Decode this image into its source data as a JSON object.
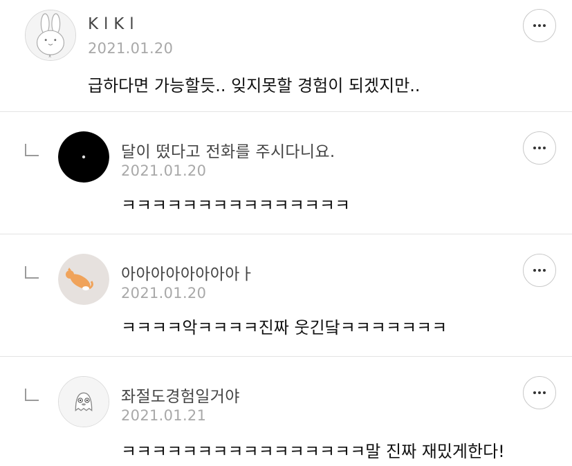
{
  "comments": [
    {
      "nickname": "K l K l",
      "date": "2021.01.20",
      "text": "급하다면 가능할듯.. 잊지못할 경험이 되겠지만..",
      "avatar_icon": "bunny-avatar-icon",
      "is_reply": false
    },
    {
      "nickname": "달이 떴다고 전화를 주시다니요.",
      "date": "2021.01.20",
      "text": "ㅋㅋㅋㅋㅋㅋㅋㅋㅋㅋㅋㅋㅋㅋㅋ",
      "avatar_icon": "black-circle-avatar-icon",
      "is_reply": true
    },
    {
      "nickname": "아아아아아아아아ㅏ",
      "date": "2021.01.20",
      "text": "ㅋㅋㅋㅋ악ㅋㅋㅋㅋ진짜 웃긴닼ㅋㅋㅋㅋㅋㅋㅋ",
      "avatar_icon": "cat-avatar-icon",
      "is_reply": true
    },
    {
      "nickname": "좌절도경험일거야",
      "date": "2021.01.21",
      "text": "ㅋㅋㅋㅋㅋㅋㅋㅋㅋㅋㅋㅋㅋㅋㅋㅋ말 진짜 재밌게한다!",
      "avatar_icon": "ghost-avatar-icon",
      "is_reply": true
    }
  ],
  "more_icon": "more-options-icon",
  "reply_icon": "reply-arrow-icon",
  "colors": {
    "nickname": "#444444",
    "date": "#a8a8a8",
    "text": "#111111",
    "divider": "#e3e3e3",
    "button_border": "#c9c9c9"
  }
}
